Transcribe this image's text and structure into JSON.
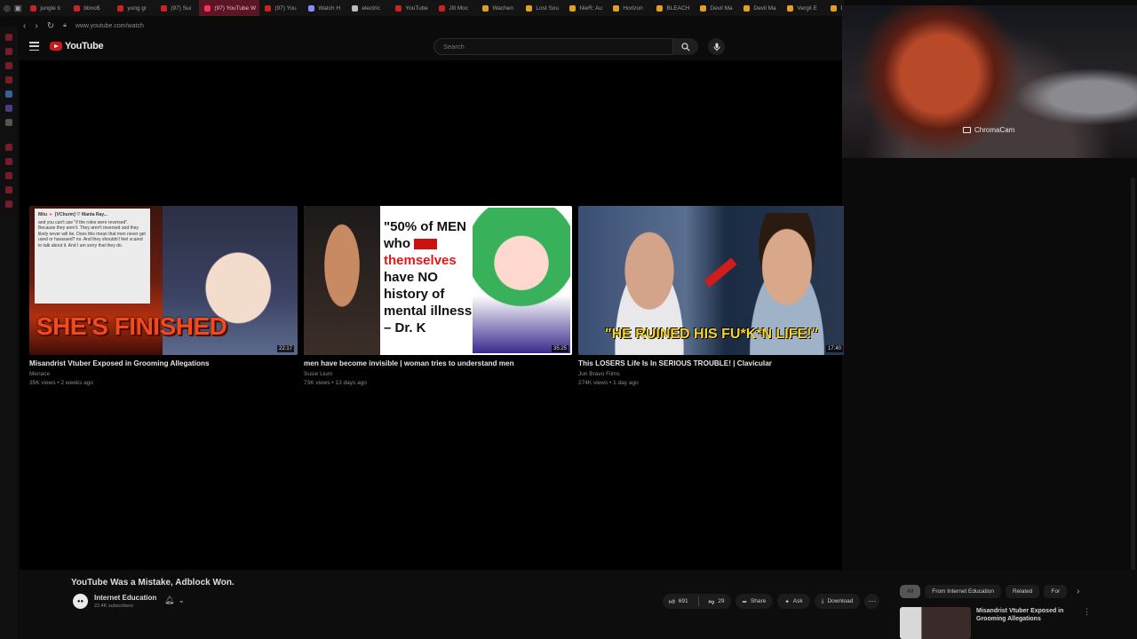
{
  "browser": {
    "tabs": [
      {
        "label": "jungle ti",
        "color": "#cc2222"
      },
      {
        "label": "bbno$",
        "color": "#cc2222"
      },
      {
        "label": "yung gr",
        "color": "#cc2222"
      },
      {
        "label": "(97) Sui",
        "color": "#cc2222"
      },
      {
        "label": "(97) YouTube W",
        "color": "#ff3355",
        "active": true
      },
      {
        "label": "(97) You",
        "color": "#cc2222"
      },
      {
        "label": "Watch H",
        "color": "#8a8aff"
      },
      {
        "label": "electric",
        "color": "#bbbbbb"
      },
      {
        "label": "YouTube",
        "color": "#cc2222"
      },
      {
        "label": "Jill Moc",
        "color": "#cc2222"
      },
      {
        "label": "Wachen",
        "color": "#e0a020"
      },
      {
        "label": "Lost Sou",
        "color": "#e0a020"
      },
      {
        "label": "NieR: Au",
        "color": "#e0a020"
      },
      {
        "label": "Horizon",
        "color": "#e0a020"
      },
      {
        "label": "BLEACH",
        "color": "#e0a020"
      },
      {
        "label": "Devil Ma",
        "color": "#e0a020"
      },
      {
        "label": "Devil Ma",
        "color": "#e0a020"
      },
      {
        "label": "Vergil E",
        "color": "#e0a020"
      },
      {
        "label": "DmC: D",
        "color": "#e0a020"
      }
    ],
    "url": "www.youtube.com/watch"
  },
  "masthead": {
    "logo_text": "YouTube",
    "search_placeholder": "Search"
  },
  "end_screen": [
    {
      "title": "Misandrist Vtuber Exposed in Grooming Allegations",
      "channel": "Menace",
      "meta": "35K views • 2 weeks ago",
      "duration": "22:17",
      "thumb_text": "SHE'S FINISHED",
      "tweet_header": "Miiu 🍬 [VChurm] ♡ Manta Ray...",
      "tweet_body": "and you can't use \"if the roles were reversed\". Because they aren't. They aren't reversed and they likely never will be. Does this mean that men never get used or harassed? no. And they shouldn't feel scared to talk about it. And I am sorry that they do."
    },
    {
      "title": "men have become invisible | woman tries to understand men",
      "channel": "Susie Lium",
      "meta": "73K views • 13 days ago",
      "duration": "35:25",
      "quote_line1": "\"50% of MEN",
      "quote_line2": "who",
      "quote_line3": "themselves",
      "quote_line4": "have NO",
      "quote_line5": "history of",
      "quote_line6": "mental illness\"",
      "quote_line7": "– Dr. K"
    },
    {
      "title": "This LOSERS Life Is In SERIOUS TROUBLE! | Clavicular",
      "channel": "Jon Bravo Films",
      "meta": "274K views • 1 day ago",
      "duration": "17:40",
      "thumb_text": "\"HE RUINED HIS FU*K*N LIFE!\""
    }
  ],
  "overlay": {
    "label": "ChromaCam"
  },
  "watch": {
    "title": "YouTube Was a Mistake, Adblock Won.",
    "channel": "Internet Education",
    "subscribers": "22.4K subscribers",
    "likes": "691",
    "dislikes": "29",
    "share": "Share",
    "ask": "Ask",
    "download": "Download"
  },
  "chips": [
    "All",
    "From Internet Education",
    "Related",
    "For"
  ],
  "up_next": {
    "title": "Misandrist Vtuber Exposed in Grooming Allegations"
  },
  "colors": {
    "accent": "#cc1a1a",
    "background": "#0b0b0b"
  }
}
